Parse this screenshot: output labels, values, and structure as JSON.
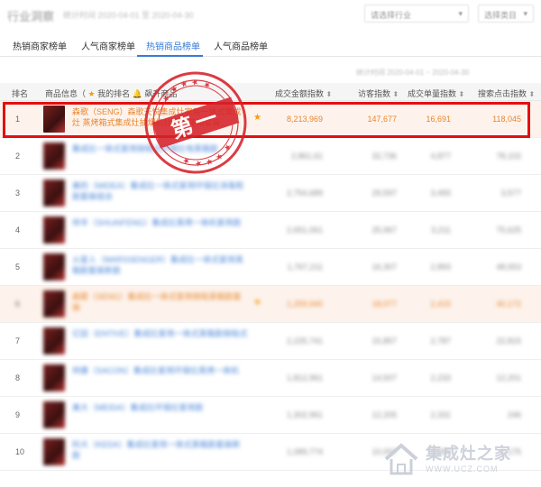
{
  "header": {
    "title": "行业洞察",
    "subtitle": "统计时间 2020-04-01 至 2020-04-30",
    "dropdown1": "请选择行业",
    "dropdown2": "选择类目"
  },
  "tabs": [
    {
      "label": "热销商家榜单"
    },
    {
      "label": "人气商家榜单"
    },
    {
      "label": "热销商品榜单"
    },
    {
      "label": "人气商品榜单"
    }
  ],
  "active_tab": 2,
  "date_note": "统计时间 2020-04-01 ~ 2020-04-30",
  "table": {
    "headers": {
      "rank": "排名",
      "product": "商品信息（",
      "my_rank": "我的排名",
      "rising": "飙升商品",
      "gmv": "成交金额指数",
      "visitors": "访客指数",
      "conversion": "成交单量指数",
      "search": "搜索点击指数"
    },
    "highlight_row": {
      "rank": "1",
      "name": "森歌（SENG）森歌天悦集成灶家用一体式集成灶 蒸烤箱式集成灶抽烟机灶具电蒸箱套装",
      "gmv": "8,213,969",
      "visitors": "147,677",
      "conversion": "16,691",
      "search": "118,045"
    },
    "rows": [
      {
        "rank": "2",
        "name": "集成灶一体式家用侧吸式环保灶电蒸箱款",
        "gmv": "2,861,61",
        "visitors": "32,736",
        "conversion": "4,877",
        "search": "78,102"
      },
      {
        "rank": "3",
        "name": "美的（MIDEA）集成灶一体式家用环保灶消毒柜款套装组合",
        "gmv": "2,754,689",
        "visitors": "29,597",
        "conversion": "3,455",
        "search": "3,577"
      },
      {
        "rank": "4",
        "name": "帅丰（SHUAIFENG）集成灶蒸烤一体机家用款",
        "gmv": "2,651,061",
        "visitors": "25,967",
        "conversion": "3,211",
        "search": "75,625"
      },
      {
        "rank": "5",
        "name": "火星人（MARSSENGER）集成灶一体式家用蒸箱款套装新款",
        "gmv": "1,767,211",
        "visitors": "16,307",
        "conversion": "2,893",
        "search": "48,553"
      },
      {
        "rank": "6",
        "name": "森歌（SENG）集成灶一体式家用侧吸蒸箱款套装",
        "gmv": "1,259,940",
        "visitors": "18,077",
        "conversion": "2,415",
        "search": "40,172"
      },
      {
        "rank": "7",
        "name": "亿田（ENTIVE）集成灶家用一体式蒸箱款侧吸式",
        "gmv": "2,225,741",
        "visitors": "15,857",
        "conversion": "2,787",
        "search": "22,815"
      },
      {
        "rank": "8",
        "name": "帅康（SACON）集成灶家用环保灶蒸烤一体机",
        "gmv": "1,812,961",
        "visitors": "14,507",
        "conversion": "2,233",
        "search": "12,201"
      },
      {
        "rank": "9",
        "name": "美大（MEIDA）集成灶环保灶家用款",
        "gmv": "1,302,961",
        "visitors": "12,205",
        "conversion": "2,331",
        "search": "246"
      },
      {
        "rank": "10",
        "name": "科大（KEDA）集成灶家用一体式蒸箱款套装新款",
        "gmv": "1,089,774",
        "visitors": "10,097",
        "conversion": "1,955",
        "search": "1,175"
      }
    ]
  },
  "stamp": {
    "text": "第一"
  },
  "watermark": {
    "text": "集成灶之家",
    "url": "WWW.UCZ.COM"
  },
  "colors": {
    "accent": "#3a7bd5",
    "highlight_border": "#e21010",
    "highlight_text": "#e8862e",
    "stamp": "#d6222a"
  }
}
